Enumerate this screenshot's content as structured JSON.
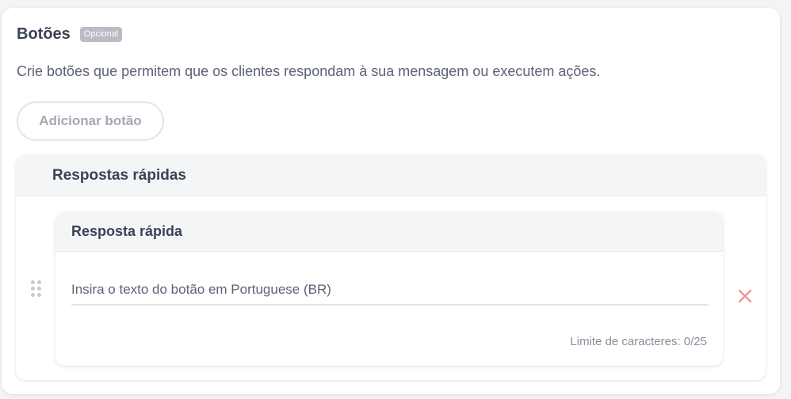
{
  "section": {
    "title": "Botões",
    "badge": "Opcional",
    "description": "Crie botões que permitem que os clientes respondam à sua mensagem ou executem ações.",
    "add_button_label": "Adicionar botão"
  },
  "group": {
    "title": "Respostas rápidas",
    "items": [
      {
        "title": "Resposta rápida",
        "input_placeholder": "Insira o texto do botão em Portuguese (BR)",
        "input_value": "",
        "char_limit_label": "Limite de caracteres:",
        "char_count": "0/25"
      }
    ]
  },
  "icons": {
    "drag": "drag-handle-icon",
    "delete": "close-icon"
  },
  "colors": {
    "delete": "#f08a8a",
    "badge_bg": "#b9bbc5"
  }
}
